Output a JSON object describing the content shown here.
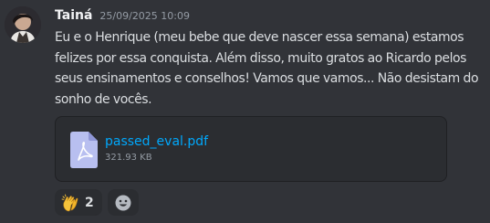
{
  "message": {
    "username": "Tainá",
    "timestamp": "25/09/2025 10:09",
    "text": "Eu e o Henrique (meu bebe que deve nascer essa semana) estamos felizes por essa conquista. Além disso, muito gratos ao Ricardo pelos seus ensinamentos e conselhos! Vamos que vamos... Não desistam do sonho de vocês.",
    "avatar_icon": "user-avatar"
  },
  "attachment": {
    "file_name": "passed_eval.pdf",
    "file_size": "321.93 KB",
    "icon": "pdf-file-icon"
  },
  "reactions": [
    {
      "emoji": "clapping-hands",
      "count": "2"
    }
  ],
  "add_reaction_icon": "smiley-icon",
  "colors": {
    "background": "#313338",
    "link": "#00a8fc",
    "attachment_bg": "#2b2d31",
    "file_icon": "#b8bff0"
  }
}
